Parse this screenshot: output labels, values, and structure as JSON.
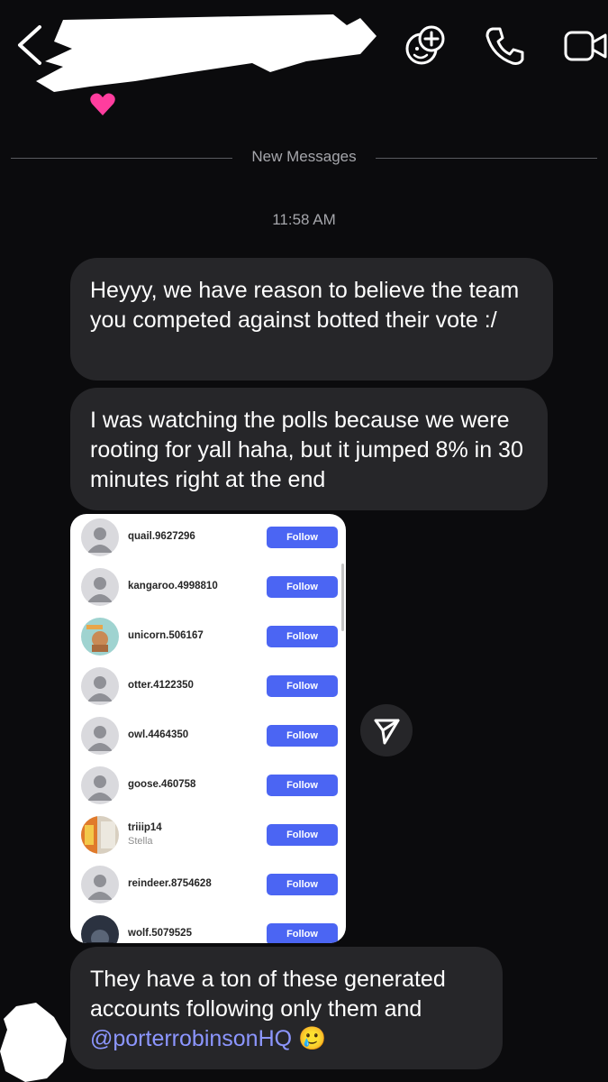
{
  "header": {
    "back_icon": "chevron-left-icon",
    "contact_name": "",
    "actions": [
      {
        "name": "sticker-add-icon"
      },
      {
        "name": "phone-icon"
      },
      {
        "name": "video-camera-icon"
      }
    ]
  },
  "reaction_emoji": "pink-heart-icon",
  "divider": {
    "label": "New Messages"
  },
  "timestamp": "11:58 AM",
  "messages": {
    "m1": "Heyyy, we have reason to believe the team you competed against botted their vote :/",
    "m2": "I was watching the polls because we were rooting for yall haha, but it jumped 8% in 30 minutes right at the end",
    "m3_text": "They have a ton of these generated accounts following only them and ",
    "m3_mention": "@porterrobinsonHQ",
    "m3_emoji": "🥲"
  },
  "screenshot": {
    "rows": [
      {
        "username": "quail.9627296",
        "subtitle": "",
        "button": "Follow"
      },
      {
        "username": "kangaroo.4998810",
        "subtitle": "",
        "button": "Follow"
      },
      {
        "username": "unicorn.506167",
        "subtitle": "",
        "button": "Follow"
      },
      {
        "username": "otter.4122350",
        "subtitle": "",
        "button": "Follow"
      },
      {
        "username": "owl.4464350",
        "subtitle": "",
        "button": "Follow"
      },
      {
        "username": "goose.460758",
        "subtitle": "",
        "button": "Follow"
      },
      {
        "username": "triiip14",
        "subtitle": "Stella",
        "button": "Follow"
      },
      {
        "username": "reindeer.8754628",
        "subtitle": "",
        "button": "Follow"
      },
      {
        "username": "wolf.5079525",
        "subtitle": "",
        "button": "Follow"
      }
    ]
  },
  "colors": {
    "background": "#0b0b0d",
    "bubble": "#262629",
    "follow_button": "#4b65f3",
    "mention": "#8c96ff",
    "muted_text": "#a5a6ab"
  }
}
